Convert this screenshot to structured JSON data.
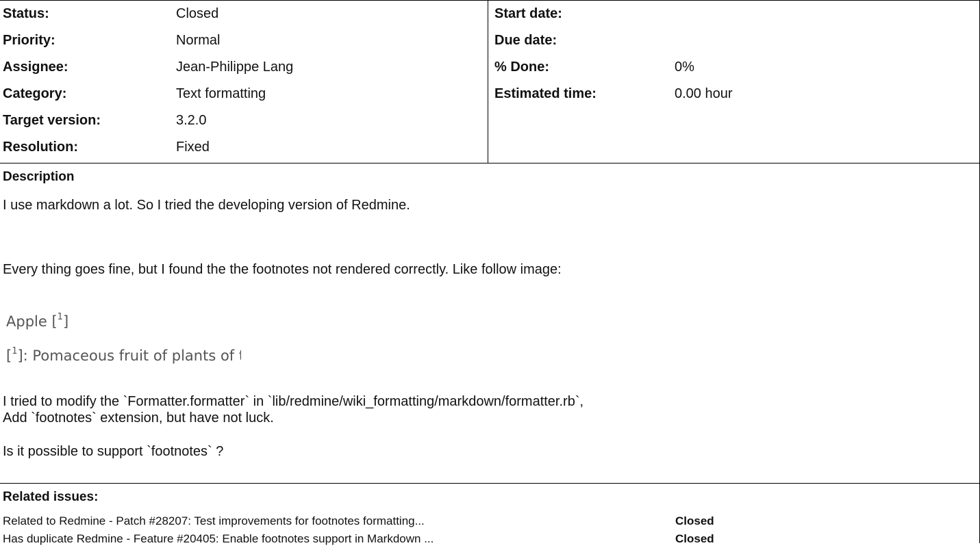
{
  "attributes_left": [
    {
      "label": "Status:",
      "value": "Closed"
    },
    {
      "label": "Priority:",
      "value": "Normal"
    },
    {
      "label": "Assignee:",
      "value": "Jean-Philippe Lang"
    },
    {
      "label": "Category:",
      "value": "Text formatting"
    },
    {
      "label": "Target version:",
      "value": "3.2.0"
    },
    {
      "label": "Resolution:",
      "value": "Fixed"
    }
  ],
  "attributes_right": [
    {
      "label": "Start date:",
      "value": ""
    },
    {
      "label": "Due date:",
      "value": ""
    },
    {
      "label": "% Done:",
      "value": "0%"
    },
    {
      "label": "Estimated time:",
      "value": "0.00 hour"
    }
  ],
  "description": {
    "title": "Description",
    "para1": "I use markdown a lot. So I tried the developing version of Redmine.",
    "para2": "Every thing goes fine, but I found the the footnotes not rendered correctly. Like follow image:",
    "image": {
      "line1_text": "Apple [",
      "line1_sup": "1",
      "line1_end": "]",
      "line2_start": "[",
      "line2_sup": "1",
      "line2_text": "]: Pomaceous fruit of plants of the g"
    },
    "para3_line1": "I tried to modify the `Formatter.formatter` in `lib/redmine/wiki_formatting/markdown/formatter.rb`,",
    "para3_line2": "Add `footnotes` extension, but have not luck.",
    "para4": "Is it possible to support `footnotes` ?"
  },
  "related": {
    "title": "Related issues:",
    "items": [
      {
        "text": "Related to Redmine - Patch #28207: Test improvements for footnotes formatting...",
        "status": "Closed"
      },
      {
        "text": "Has duplicate Redmine - Feature #20405: Enable footnotes support in Markdown ...",
        "status": "Closed"
      }
    ]
  }
}
